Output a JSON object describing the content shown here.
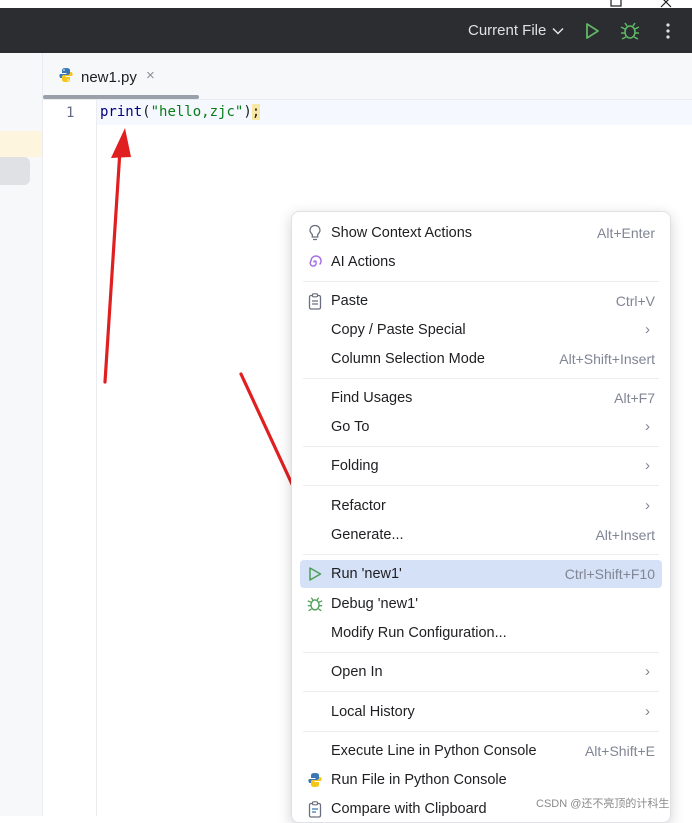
{
  "toolbar": {
    "run_config": "Current File",
    "colors": {
      "run": "#5fb865",
      "debug": "#5fb865",
      "background": "#2b2d30"
    }
  },
  "tab": {
    "label": "new1.py",
    "close": "×"
  },
  "editor": {
    "line_number": "1",
    "code": {
      "func": "print",
      "open": "(",
      "string": "\"hello,zjc\"",
      "close": ")",
      "semi": ";"
    }
  },
  "menu": {
    "items": [
      {
        "label": "Show Context Actions",
        "shortcut": "Alt+Enter",
        "icon": "lightbulb-icon"
      },
      {
        "label": "AI Actions",
        "shortcut": "",
        "icon": "ai-spiral-icon"
      },
      {
        "label": "Paste",
        "shortcut": "Ctrl+V",
        "icon": "clipboard-icon"
      },
      {
        "label": "Copy / Paste Special",
        "shortcut": "",
        "submenu": true
      },
      {
        "label": "Column Selection Mode",
        "shortcut": "Alt+Shift+Insert"
      },
      {
        "label": "Find Usages",
        "shortcut": "Alt+F7"
      },
      {
        "label": "Go To",
        "shortcut": "",
        "submenu": true
      },
      {
        "label": "Folding",
        "shortcut": "",
        "submenu": true
      },
      {
        "label": "Refactor",
        "shortcut": "",
        "submenu": true
      },
      {
        "label": "Generate...",
        "shortcut": "Alt+Insert"
      },
      {
        "label": "Run 'new1'",
        "shortcut": "Ctrl+Shift+F10",
        "icon": "run-icon",
        "selected": true
      },
      {
        "label": "Debug 'new1'",
        "shortcut": "",
        "icon": "debug-icon"
      },
      {
        "label": "Modify Run Configuration...",
        "shortcut": ""
      },
      {
        "label": "Open In",
        "shortcut": "",
        "submenu": true
      },
      {
        "label": "Local History",
        "shortcut": "",
        "submenu": true
      },
      {
        "label": "Execute Line in Python Console",
        "shortcut": "Alt+Shift+E"
      },
      {
        "label": "Run File in Python Console",
        "shortcut": "",
        "icon": "python-icon"
      },
      {
        "label": "Compare with Clipboard",
        "shortcut": "",
        "icon": "compare-icon"
      }
    ],
    "submenu_arrow": "›"
  },
  "watermark": "CSDN @还不亮顶的计科生"
}
